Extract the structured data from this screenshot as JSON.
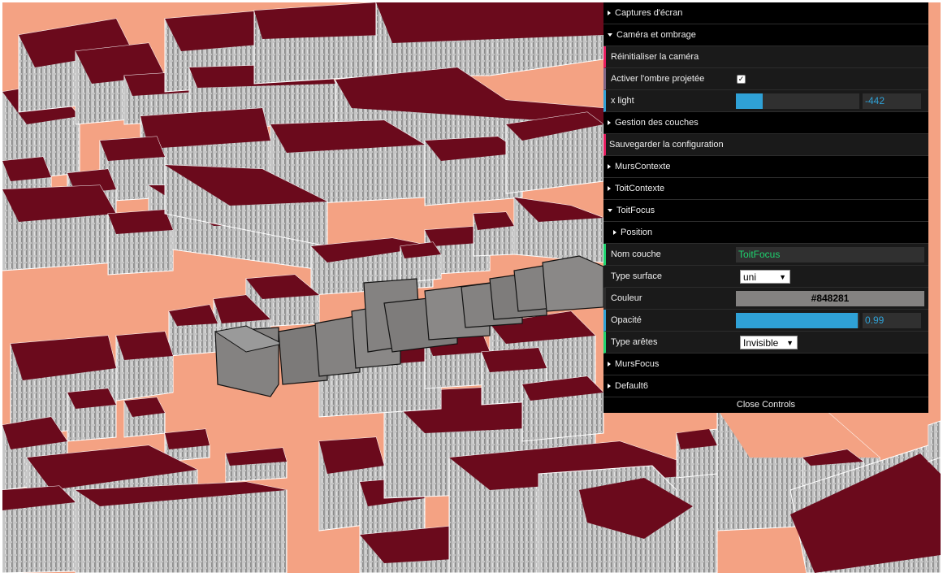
{
  "gui": {
    "folders": {
      "captures": "Captures d'écran",
      "camera": "Caméra et ombrage",
      "layers": "Gestion des couches",
      "murs_contexte": "MursContexte",
      "toit_contexte": "ToitContexte",
      "toit_focus": "ToitFocus",
      "position": "Position",
      "murs_focus": "MursFocus",
      "default6": "Default6"
    },
    "reset_camera": "Réinitialiser la caméra",
    "shadow": {
      "label": "Activer l'ombre projetée",
      "checked": true,
      "mark": "✓"
    },
    "x_light": {
      "label": "x light",
      "value": "-442",
      "fraction": 0.22
    },
    "save_config": "Sauvegarder la configuration",
    "layer_name": {
      "label": "Nom couche",
      "value": "ToitFocus"
    },
    "surface_type": {
      "label": "Type surface",
      "value": "uni"
    },
    "color": {
      "label": "Couleur",
      "value": "#848281"
    },
    "opacity": {
      "label": "Opacité",
      "value": "0.99",
      "fraction": 0.99
    },
    "edge_type": {
      "label": "Type arêtes",
      "value": "Invisible"
    },
    "close_controls": "Close Controls"
  },
  "colors": {
    "ground": "#f4a283",
    "roof": "#6b0a1c",
    "wall": "#bdbdbd",
    "focus": "#848281"
  }
}
